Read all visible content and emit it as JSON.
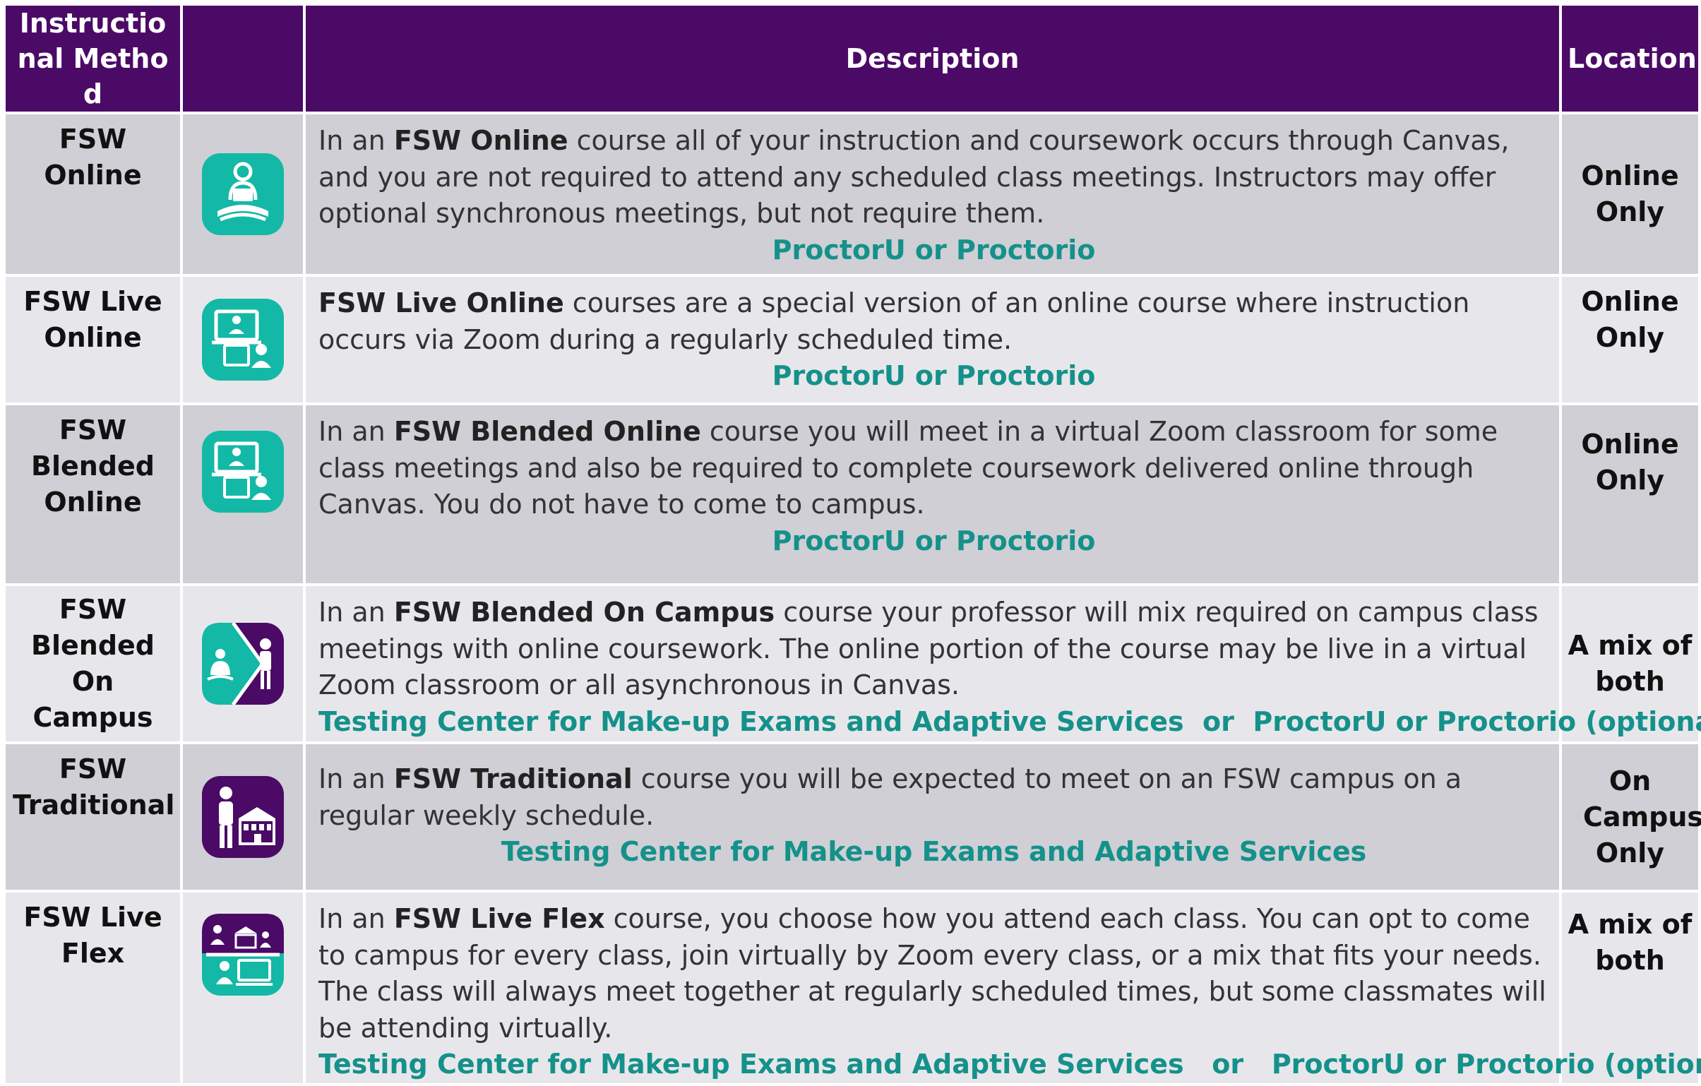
{
  "header": {
    "method": "Instructional Method",
    "icon": "",
    "description": "Description",
    "location": "Location"
  },
  "rows": [
    {
      "method": "FSW Online",
      "icon": "person-laptop-icon",
      "desc_pre": "In an ",
      "desc_bold": "FSW Online",
      "desc_post": " course all of your instruction and coursework occurs through Canvas, and you are not required to attend any scheduled class meetings. Instructors may offer optional synchronous meetings, but not require them.",
      "testing": "ProctorU or Proctorio",
      "location": "Online Only"
    },
    {
      "method": "FSW Live Online",
      "icon": "virtual-classroom-icon",
      "desc_pre": "",
      "desc_bold": "FSW Live Online",
      "desc_post": " courses are a special version of an online course where instruction occurs via Zoom during a regularly scheduled time.",
      "testing": "ProctorU or Proctorio",
      "location": "Online Only"
    },
    {
      "method": "FSW Blended Online",
      "icon": "virtual-classroom-icon",
      "desc_pre": "In an ",
      "desc_bold": "FSW Blended Online",
      "desc_post": " course you will meet in a virtual Zoom classroom for some class meetings and also be required to complete coursework delivered online through Canvas. You do not have to come to campus.",
      "testing": "ProctorU or Proctorio",
      "location": "Online Only"
    },
    {
      "method": "FSW Blended On Campus",
      "icon": "blended-campus-icon",
      "desc_pre": "In an ",
      "desc_bold": "FSW Blended On Campus",
      "desc_post": " course your professor will mix required on campus class meetings with online coursework. The online portion of the course may be live in a virtual Zoom classroom or all asynchronous in Canvas.",
      "testing": "Testing Center for Make-up Exams and Adaptive Services  or  ProctorU or Proctorio (optional)",
      "location": "A mix of both"
    },
    {
      "method": "FSW Traditional",
      "icon": "student-campus-building-icon",
      "desc_pre": "In an ",
      "desc_bold": "FSW Traditional",
      "desc_post": " course you will be expected to meet on an FSW campus on a regular weekly schedule.",
      "testing": "Testing Center for Make-up Exams and Adaptive Services",
      "location": "On Campus Only"
    },
    {
      "method": "FSW Live Flex",
      "icon": "live-flex-icon",
      "desc_pre": "In an ",
      "desc_bold": "FSW Live Flex",
      "desc_post": " course, you choose how you attend each class. You can opt to come to campus for every class, join virtually by Zoom every class, or a mix that fits your needs. The class will always meet together at regularly scheduled times, but some classmates will be attending virtually.",
      "testing": "Testing Center for Make-up Exams and Adaptive Services   or   ProctorU or Proctorio (optional)",
      "location": "A mix of both"
    }
  ],
  "colors": {
    "header_bg": "#4b0a66",
    "row_dark": "#cfcfd5",
    "row_light": "#e7e7eb",
    "teal": "#14b8a6",
    "purple": "#4b0a66",
    "testing_text": "#14918a"
  }
}
